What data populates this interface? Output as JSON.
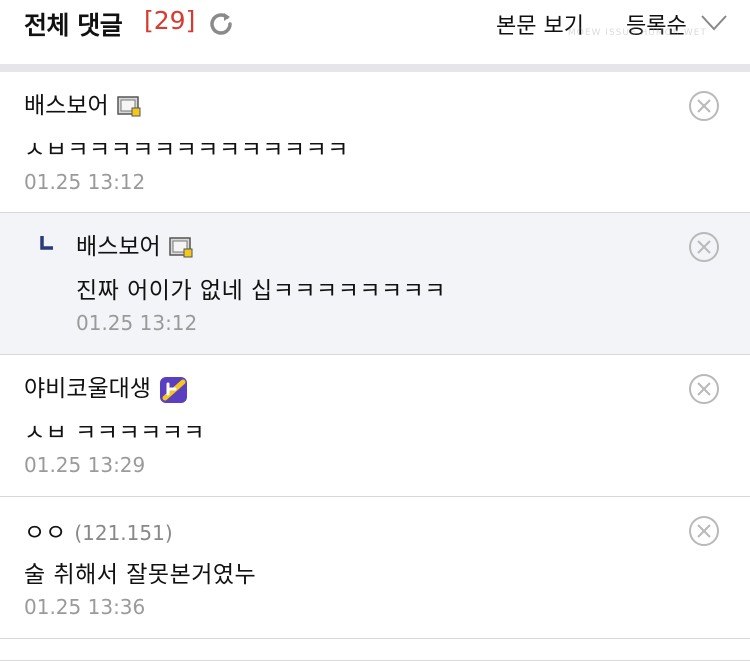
{
  "header": {
    "title": "전체 댓글",
    "count": "[29]",
    "view_body": "본문 보기",
    "sort": "등록순",
    "watermark": "MOEW ISSUE HUMOR WET"
  },
  "comments": [
    {
      "nickname": "배스보어",
      "ip": "",
      "text": "ㅅㅂㅋㅋㅋㅋㅋㅋㅋㅋㅋㅋㅋㅋㅋ",
      "date": "01.25 13:12",
      "badge": "member-icon",
      "reply": false
    },
    {
      "nickname": "배스보어",
      "ip": "",
      "text": "진짜 어이가 없네 십ㅋㅋㅋㅋㅋㅋㅋㅋ",
      "date": "01.25 13:12",
      "badge": "member-icon",
      "reply": true
    },
    {
      "nickname": "야비코울대생",
      "ip": "",
      "text": "ㅅㅂ ㅋㅋㅋㅋㅋㅋ",
      "date": "01.25 13:29",
      "badge": "app-badge-icon",
      "reply": false
    },
    {
      "nickname": "ㅇㅇ",
      "ip": "(121.151)",
      "text": "술 취해서 잘못본거였누",
      "date": "01.25 13:36",
      "badge": "",
      "reply": false
    }
  ],
  "colors": {
    "accent": "#d63b2f",
    "reply_bg": "#f3f4f7",
    "badge_bg": "#5a3fc0"
  }
}
